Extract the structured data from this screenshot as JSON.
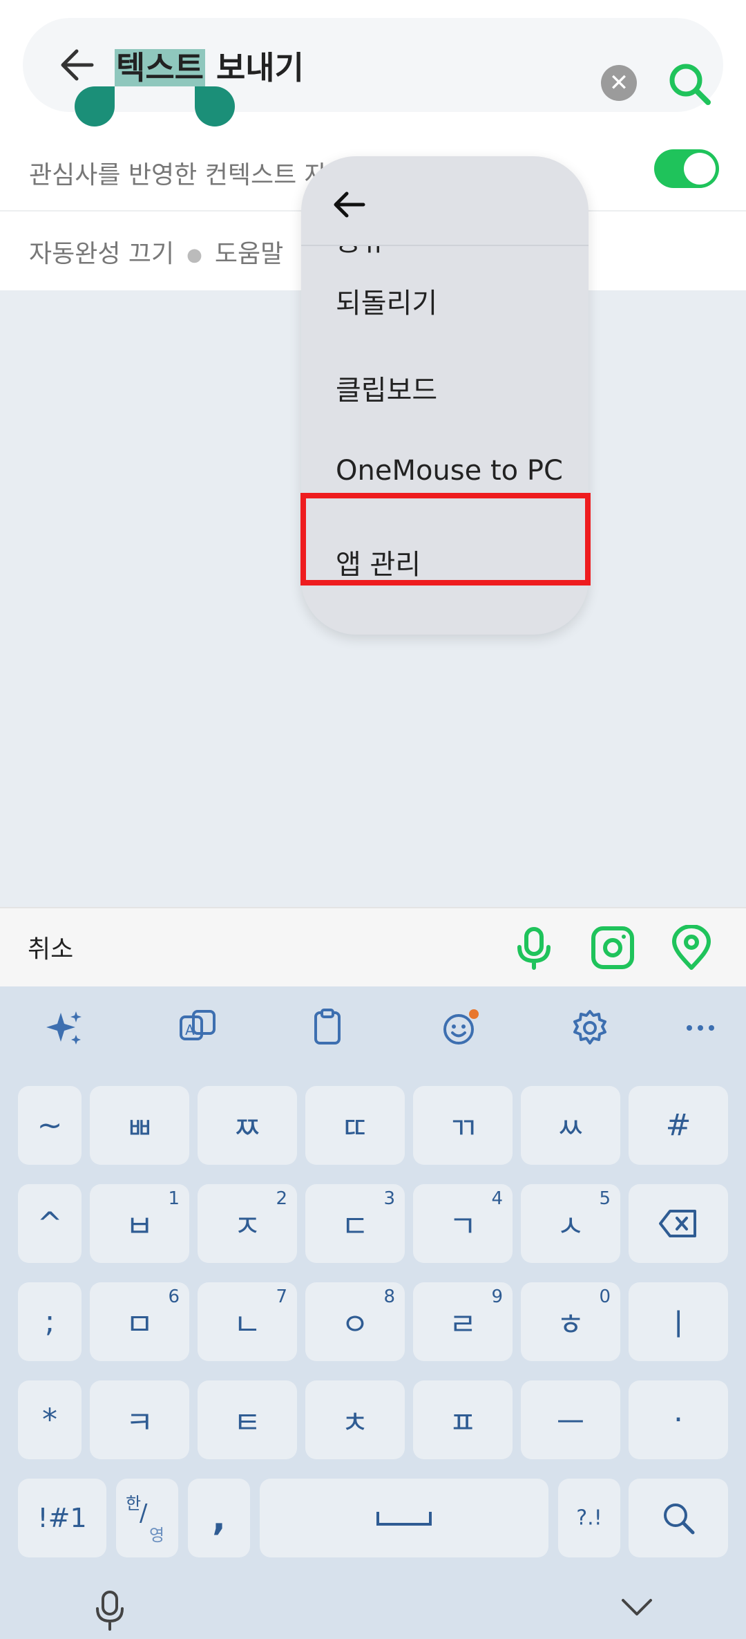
{
  "search": {
    "query_selected": "텍스트",
    "query_rest": " 보내기"
  },
  "context_row": {
    "label": "관심사를 반영한 컨텍스트 자",
    "toggle_on": true
  },
  "links": {
    "autocomplete_off": "자동완성 끄기",
    "help": "도움말"
  },
  "popup_menu": {
    "items": [
      "공유",
      "되돌리기",
      "클립보드",
      "OneMouse to PC",
      "앱 관리"
    ]
  },
  "action_bar": {
    "cancel_label": "취소"
  },
  "keyboard": {
    "row1": [
      "~",
      "ㅃ",
      "ㅉ",
      "ㄸ",
      "ㄲ",
      "ㅆ",
      "#"
    ],
    "row2": [
      {
        "main": "^",
        "sub": ""
      },
      {
        "main": "ㅂ",
        "sub": "1"
      },
      {
        "main": "ㅈ",
        "sub": "2"
      },
      {
        "main": "ㄷ",
        "sub": "3"
      },
      {
        "main": "ㄱ",
        "sub": "4"
      },
      {
        "main": "ㅅ",
        "sub": "5"
      }
    ],
    "row3": [
      {
        "main": ";",
        "sub": ""
      },
      {
        "main": "ㅁ",
        "sub": "6"
      },
      {
        "main": "ㄴ",
        "sub": "7"
      },
      {
        "main": "ㅇ",
        "sub": "8"
      },
      {
        "main": "ㄹ",
        "sub": "9"
      },
      {
        "main": "ㅎ",
        "sub": "0"
      },
      {
        "main": "ㅣ",
        "sub": ""
      }
    ],
    "row4": [
      "*",
      "ㅋ",
      "ㅌ",
      "ㅊ",
      "ㅍ",
      "ㅡ",
      "·"
    ],
    "row5": {
      "symbols": "!#1",
      "lang_top": "한",
      "lang_bottom": "영",
      "comma": ",",
      "punct": "?.!"
    }
  },
  "colors": {
    "accent_green": "#1fc35b",
    "selection": "#8fc7bd",
    "highlight_red": "#ee1c1f",
    "key_text": "#2f5c93"
  }
}
